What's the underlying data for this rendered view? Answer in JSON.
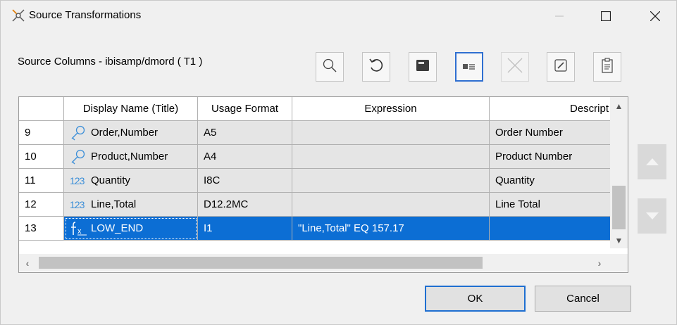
{
  "window": {
    "title": "Source Transformations"
  },
  "source_label": "Source Columns - ibisamp/dmord ( T1 )",
  "toolbar": [
    {
      "icon": "search-icon"
    },
    {
      "icon": "undo-icon"
    },
    {
      "icon": "save-icon"
    },
    {
      "icon": "card-view-icon",
      "active": true
    },
    {
      "icon": "delete-icon",
      "disabled": true
    },
    {
      "icon": "edit-icon"
    },
    {
      "icon": "clipboard-icon"
    }
  ],
  "grid": {
    "headers": [
      "",
      "Display Name (Title)",
      "Usage Format",
      "Expression",
      "Descript"
    ],
    "rows": [
      {
        "num": "9",
        "icon": "key-icon",
        "name": "Order,Number",
        "format": "A5",
        "expression": "",
        "description": "Order Number"
      },
      {
        "num": "10",
        "icon": "key-icon",
        "name": "Product,Number",
        "format": "A4",
        "expression": "",
        "description": "Product Number"
      },
      {
        "num": "11",
        "icon": "measure-icon",
        "icon_text": "123",
        "name": "Quantity",
        "format": "I8C",
        "expression": "",
        "description": "Quantity"
      },
      {
        "num": "12",
        "icon": "measure-icon",
        "icon_text": "123",
        "name": "Line,Total",
        "format": "D12.2MC",
        "expression": "",
        "description": "Line Total"
      },
      {
        "num": "13",
        "icon": "formula-icon",
        "icon_text": "fx",
        "name": "LOW_END",
        "format": "I1",
        "expression": "\"Line,Total\" EQ 157.17",
        "description": "",
        "selected": true
      }
    ]
  },
  "buttons": {
    "ok": "OK",
    "cancel": "Cancel"
  },
  "colors": {
    "selection": "#0c6ed4",
    "icon_blue": "#3c8fd8",
    "default_button_border": "#1f6fd1"
  }
}
